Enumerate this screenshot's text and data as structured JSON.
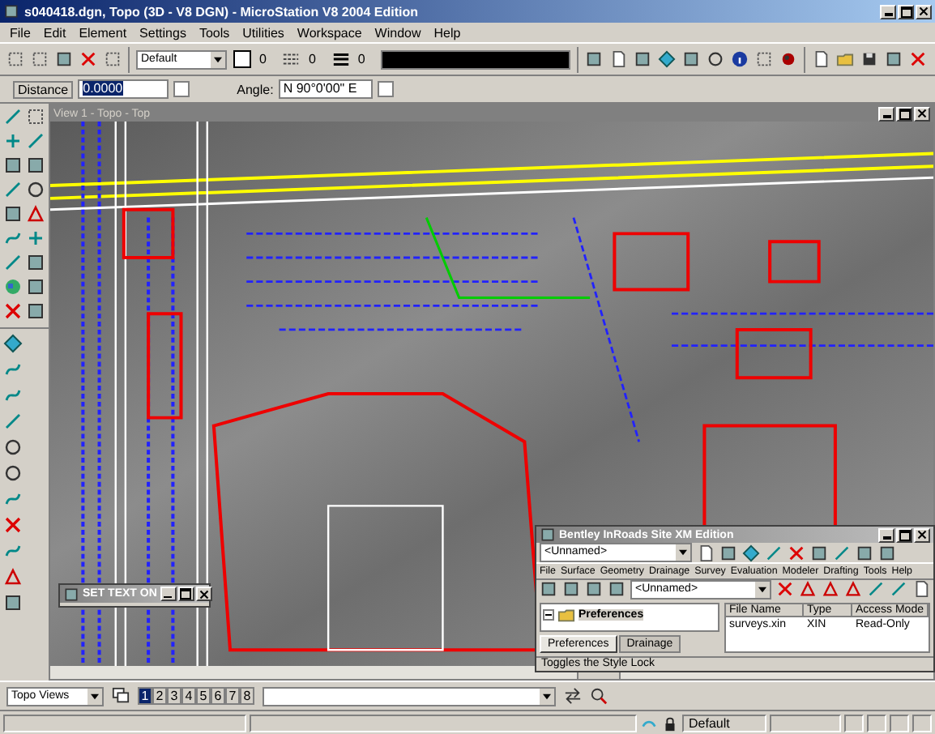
{
  "window": {
    "title": "s040418.dgn, Topo (3D - V8 DGN) - MicroStation V8 2004 Edition"
  },
  "menu": [
    "File",
    "Edit",
    "Element",
    "Settings",
    "Tools",
    "Utilities",
    "Workspace",
    "Window",
    "Help"
  ],
  "attributes": {
    "level": "Default",
    "color_index": "0",
    "style_index": "0",
    "weight_index": "0"
  },
  "accudraw": {
    "distance_label": "Distance",
    "distance": "0.0000",
    "distance_locked": false,
    "angle_label": "Angle:",
    "angle": "N 90°0'00\" E",
    "angle_locked": false
  },
  "view": {
    "title": "View 1 - Topo - Top"
  },
  "set_text_window": {
    "title": "SET TEXT ON"
  },
  "inroads": {
    "title": "Bentley InRoads Site XM Edition",
    "style": "<Unnamed>",
    "menu": [
      "File",
      "Surface",
      "Geometry",
      "Drainage",
      "Survey",
      "Evaluation",
      "Modeler",
      "Drafting",
      "Tools",
      "Help"
    ],
    "preference": "<Unnamed>",
    "tree": [
      {
        "label": "Preferences",
        "expanded": true
      }
    ],
    "tabs": [
      {
        "label": "Preferences",
        "selected": true
      },
      {
        "label": "Drainage",
        "selected": false
      }
    ],
    "columns": [
      "File Name",
      "Type",
      "Access Mode"
    ],
    "rows": [
      {
        "file_name": "surveys.xin",
        "type": "XIN",
        "access_mode": "Read-Only"
      }
    ],
    "status": "Toggles the Style Lock"
  },
  "view_bar": {
    "view_group": "Topo Views",
    "views": [
      {
        "label": "1",
        "selected": true
      },
      {
        "label": "2",
        "selected": false
      },
      {
        "label": "3",
        "selected": false
      },
      {
        "label": "4",
        "selected": false
      },
      {
        "label": "5",
        "selected": false
      },
      {
        "label": "6",
        "selected": false
      },
      {
        "label": "7",
        "selected": false
      },
      {
        "label": "8",
        "selected": false
      }
    ]
  },
  "status_bar": {
    "level": "Default"
  }
}
